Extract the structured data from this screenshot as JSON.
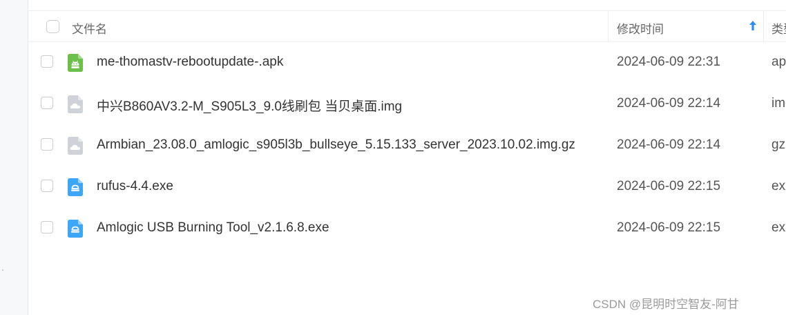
{
  "header": {
    "name_label": "文件名",
    "time_label": "修改时间",
    "type_label": "类型"
  },
  "colors": {
    "apk_icon": "#6cc04a",
    "cloud_icon": "#cfd3d9",
    "exe_icon": "#3ea6f7",
    "sort_arrow": "#2d8cf0"
  },
  "files": [
    {
      "name": "me-thomastv-rebootupdate-.apk",
      "time": "2024-06-09 22:31",
      "type": "apk",
      "icon": "android-apk-icon"
    },
    {
      "name": "中兴B860AV3.2-M_S905L3_9.0线刷包 当贝桌面.img",
      "time": "2024-06-09 22:14",
      "type": "img",
      "icon": "cloud-file-icon"
    },
    {
      "name": "Armbian_23.08.0_amlogic_s905l3b_bullseye_5.15.133_server_2023.10.02.img.gz",
      "time": "2024-06-09 22:14",
      "type": "gz",
      "icon": "cloud-file-icon"
    },
    {
      "name": "rufus-4.4.exe",
      "time": "2024-06-09 22:15",
      "type": "exe",
      "icon": "exe-file-icon"
    },
    {
      "name": "Amlogic USB Burning Tool_v2.1.6.8.exe",
      "time": "2024-06-09 22:15",
      "type": "exe",
      "icon": "exe-file-icon"
    }
  ],
  "watermark": "CSDN @昆明时空智友-阿甘"
}
